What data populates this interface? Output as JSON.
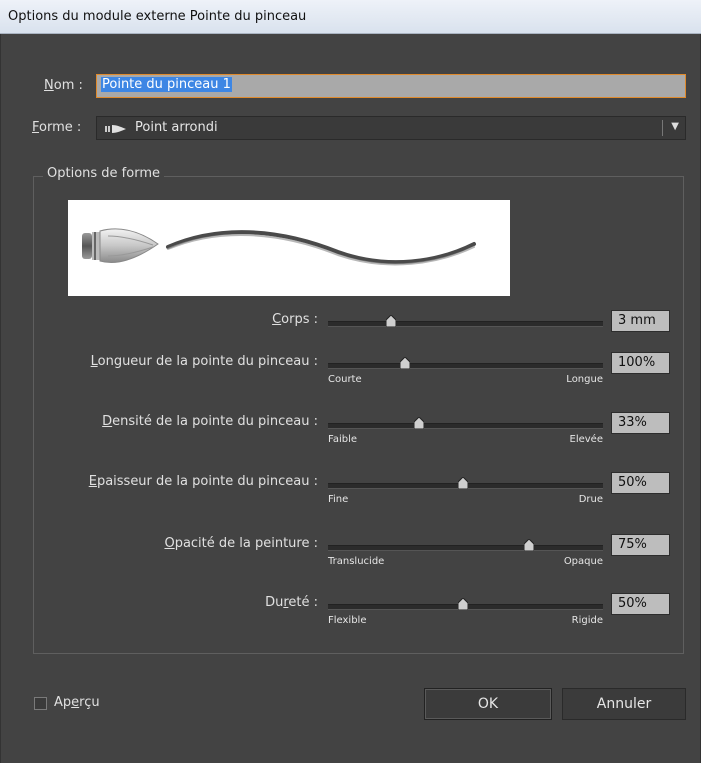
{
  "window": {
    "title": "Options du module externe Pointe du pinceau"
  },
  "name": {
    "label_u": "N",
    "label_rest": "om :",
    "value": "Pointe du pinceau 1"
  },
  "shape": {
    "label_u": "F",
    "label_rest": "orme :",
    "value": "Point arrondi",
    "icon": "brush-tip-icon"
  },
  "group": {
    "label": "Options de forme"
  },
  "sliders": [
    {
      "label_pre": "",
      "label_u": "C",
      "label_post": "orps :",
      "value_text": "3 mm",
      "fraction": 0.23,
      "min_label": "",
      "max_label": ""
    },
    {
      "label_pre": "",
      "label_u": "L",
      "label_post": "ongueur de la pointe du pinceau :",
      "value_text": "100%",
      "fraction": 0.28,
      "min_label": "Courte",
      "max_label": "Longue"
    },
    {
      "label_pre": "",
      "label_u": "D",
      "label_post": "ensité de la pointe du pinceau :",
      "value_text": "33%",
      "fraction": 0.33,
      "min_label": "Faible",
      "max_label": "Elevée"
    },
    {
      "label_pre": "",
      "label_u": "E",
      "label_post": "paisseur de la pointe du pinceau :",
      "value_text": "50%",
      "fraction": 0.49,
      "min_label": "Fine",
      "max_label": "Drue"
    },
    {
      "label_pre": "",
      "label_u": "O",
      "label_post": "pacité de la peinture :",
      "value_text": "75%",
      "fraction": 0.73,
      "min_label": "Translucide",
      "max_label": "Opaque"
    },
    {
      "label_pre": "Du",
      "label_u": "r",
      "label_post": "eté :",
      "value_text": "50%",
      "fraction": 0.49,
      "min_label": "Flexible",
      "max_label": "Rigide"
    }
  ],
  "preview_toggle": {
    "label_pre": "Ap",
    "label_u": "e",
    "label_post": "rçu",
    "checked": false
  },
  "buttons": {
    "ok": "OK",
    "cancel": "Annuler"
  },
  "colors": {
    "background": "#434343",
    "selection": "#3d86e4",
    "focus_border": "#e08a2c"
  }
}
